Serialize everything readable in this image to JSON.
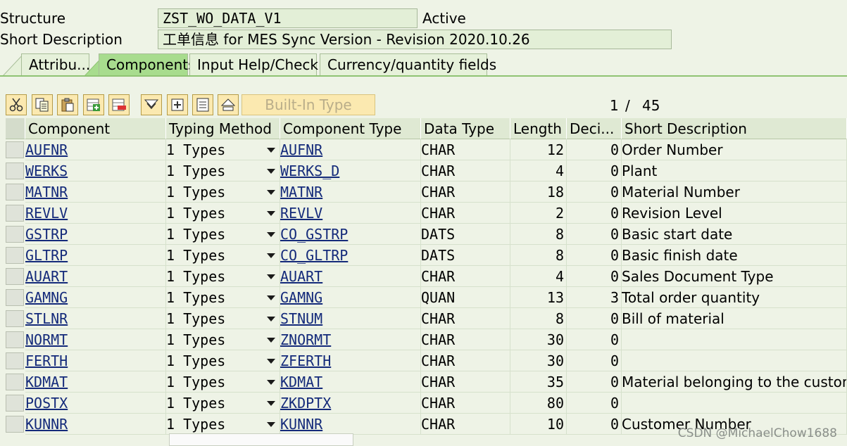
{
  "header": {
    "structure_label": "Structure",
    "structure_value": "ZST_WO_DATA_V1",
    "status": "Active",
    "short_desc_label": "Short Description",
    "short_desc_value": "工单信息 for MES Sync Version - Revision 2020.10.26"
  },
  "tabs": [
    {
      "label": "Attribu..."
    },
    {
      "label": "Components"
    },
    {
      "label": "Input Help/Check"
    },
    {
      "label": "Currency/quantity fields"
    }
  ],
  "toolbar": {
    "builtin_label": "Built-In Type",
    "page_current": "1",
    "page_sep": "/",
    "page_total": "45"
  },
  "columns": [
    "Component",
    "Typing Method",
    "Component Type",
    "Data Type",
    "Length",
    "Deci...",
    "Short Description"
  ],
  "rows": [
    {
      "component": "AUFNR",
      "method": "1 Types",
      "type": "AUFNR",
      "dtype": "CHAR",
      "length": "12",
      "deci": "0",
      "desc": "Order Number"
    },
    {
      "component": "WERKS",
      "method": "1 Types",
      "type": "WERKS_D",
      "dtype": "CHAR",
      "length": "4",
      "deci": "0",
      "desc": "Plant"
    },
    {
      "component": "MATNR",
      "method": "1 Types",
      "type": "MATNR",
      "dtype": "CHAR",
      "length": "18",
      "deci": "0",
      "desc": "Material Number"
    },
    {
      "component": "REVLV",
      "method": "1 Types",
      "type": "REVLV",
      "dtype": "CHAR",
      "length": "2",
      "deci": "0",
      "desc": "Revision Level"
    },
    {
      "component": "GSTRP",
      "method": "1 Types",
      "type": "CO_GSTRP",
      "dtype": "DATS",
      "length": "8",
      "deci": "0",
      "desc": "Basic start date"
    },
    {
      "component": "GLTRP",
      "method": "1 Types",
      "type": "CO_GLTRP",
      "dtype": "DATS",
      "length": "8",
      "deci": "0",
      "desc": "Basic finish date"
    },
    {
      "component": "AUART",
      "method": "1 Types",
      "type": "AUART",
      "dtype": "CHAR",
      "length": "4",
      "deci": "0",
      "desc": "Sales Document Type"
    },
    {
      "component": "GAMNG",
      "method": "1 Types",
      "type": "GAMNG",
      "dtype": "QUAN",
      "length": "13",
      "deci": "3",
      "desc": "Total order quantity"
    },
    {
      "component": "STLNR",
      "method": "1 Types",
      "type": "STNUM",
      "dtype": "CHAR",
      "length": "8",
      "deci": "0",
      "desc": "Bill of material"
    },
    {
      "component": "NORMT",
      "method": "1 Types",
      "type": "ZNORMT",
      "dtype": "CHAR",
      "length": "30",
      "deci": "0",
      "desc": ""
    },
    {
      "component": "FERTH",
      "method": "1 Types",
      "type": "ZFERTH",
      "dtype": "CHAR",
      "length": "30",
      "deci": "0",
      "desc": ""
    },
    {
      "component": "KDMAT",
      "method": "1 Types",
      "type": "KDMAT",
      "dtype": "CHAR",
      "length": "35",
      "deci": "0",
      "desc": "Material belonging to the customer"
    },
    {
      "component": "POSTX",
      "method": "1 Types",
      "type": "ZKDPTX",
      "dtype": "CHAR",
      "length": "80",
      "deci": "0",
      "desc": ""
    },
    {
      "component": "KUNNR",
      "method": "1 Types",
      "type": "KUNNR",
      "dtype": "CHAR",
      "length": "10",
      "deci": "0",
      "desc": "Customer Number"
    }
  ],
  "watermark": "CSDN @MichaelChow1688",
  "colors": {
    "background": "#eef3e6",
    "active_tab": "#a8dc8e",
    "toolbar_button": "#fbe9b0"
  },
  "icons": [
    "cut-icon",
    "copy-icon",
    "paste-icon",
    "insert-row-icon",
    "delete-row-icon",
    "find-icon",
    "insert-icon",
    "details-icon",
    "upload-icon"
  ]
}
